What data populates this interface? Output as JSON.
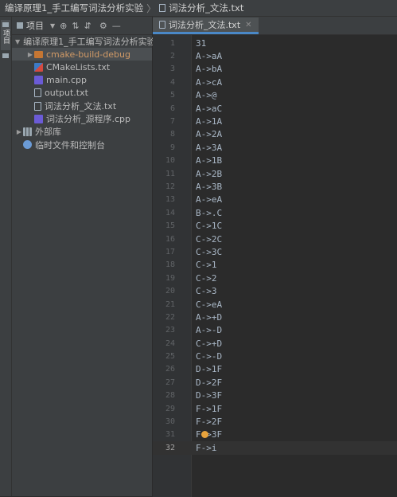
{
  "titlebar": {
    "project": "编译原理1_手工编写词法分析实验",
    "file": "词法分析_文法.txt"
  },
  "stripe": {
    "project_tab": "项目"
  },
  "panel": {
    "dropdown_label": "项目",
    "tree": [
      {
        "label": "编译原理1_手工编写词法分析实验",
        "icon": "folder-icon",
        "arrow": "▼",
        "indent": 0,
        "selected": false
      },
      {
        "label": "cmake-build-debug",
        "icon": "folder-orange-icon",
        "arrow": "▶",
        "indent": 1,
        "selected": true
      },
      {
        "label": "CMakeLists.txt",
        "icon": "cmake-icon",
        "arrow": "",
        "indent": 1,
        "selected": false
      },
      {
        "label": "main.cpp",
        "icon": "cpp-file-icon",
        "arrow": "",
        "indent": 1,
        "selected": false
      },
      {
        "label": "output.txt",
        "icon": "text-file-icon",
        "arrow": "",
        "indent": 1,
        "selected": false
      },
      {
        "label": "词法分析_文法.txt",
        "icon": "text-file-icon",
        "arrow": "",
        "indent": 1,
        "selected": false
      },
      {
        "label": "词法分析_源程序.cpp",
        "icon": "cpp-file-icon",
        "arrow": "",
        "indent": 1,
        "selected": false
      },
      {
        "label": "外部库",
        "icon": "library-icon",
        "arrow": "▶",
        "indent": 0,
        "selected": false
      },
      {
        "label": "临时文件和控制台",
        "icon": "scratch-icon",
        "arrow": "",
        "indent": 0,
        "selected": false
      }
    ]
  },
  "editor": {
    "tab_label": "词法分析_文法.txt",
    "current_line": 32,
    "lines": [
      {
        "n": "1",
        "text": "31"
      },
      {
        "n": "2",
        "text": "A->aA"
      },
      {
        "n": "3",
        "text": "A->bA"
      },
      {
        "n": "4",
        "text": "A->cA"
      },
      {
        "n": "5",
        "text": "A->@"
      },
      {
        "n": "6",
        "text": "A->aC"
      },
      {
        "n": "7",
        "text": "A->1A"
      },
      {
        "n": "8",
        "text": "A->2A"
      },
      {
        "n": "9",
        "text": "A->3A"
      },
      {
        "n": "10",
        "text": "A->1B"
      },
      {
        "n": "11",
        "text": "A->2B"
      },
      {
        "n": "12",
        "text": "A->3B"
      },
      {
        "n": "13",
        "text": "A->eA"
      },
      {
        "n": "14",
        "text": "B->.C"
      },
      {
        "n": "15",
        "text": "C->1C"
      },
      {
        "n": "16",
        "text": "C->2C"
      },
      {
        "n": "17",
        "text": "C->3C"
      },
      {
        "n": "18",
        "text": "C->1"
      },
      {
        "n": "19",
        "text": "C->2"
      },
      {
        "n": "20",
        "text": "C->3"
      },
      {
        "n": "21",
        "text": "C->eA"
      },
      {
        "n": "22",
        "text": "A->+D"
      },
      {
        "n": "23",
        "text": "A->-D"
      },
      {
        "n": "24",
        "text": "C->+D"
      },
      {
        "n": "25",
        "text": "C->-D"
      },
      {
        "n": "26",
        "text": "D->1F"
      },
      {
        "n": "27",
        "text": "D->2F"
      },
      {
        "n": "28",
        "text": "D->3F"
      },
      {
        "n": "29",
        "text": "F->1F"
      },
      {
        "n": "30",
        "text": "F->2F"
      },
      {
        "n": "31",
        "text": "F->3F"
      },
      {
        "n": "32",
        "text": "F->i"
      }
    ]
  }
}
